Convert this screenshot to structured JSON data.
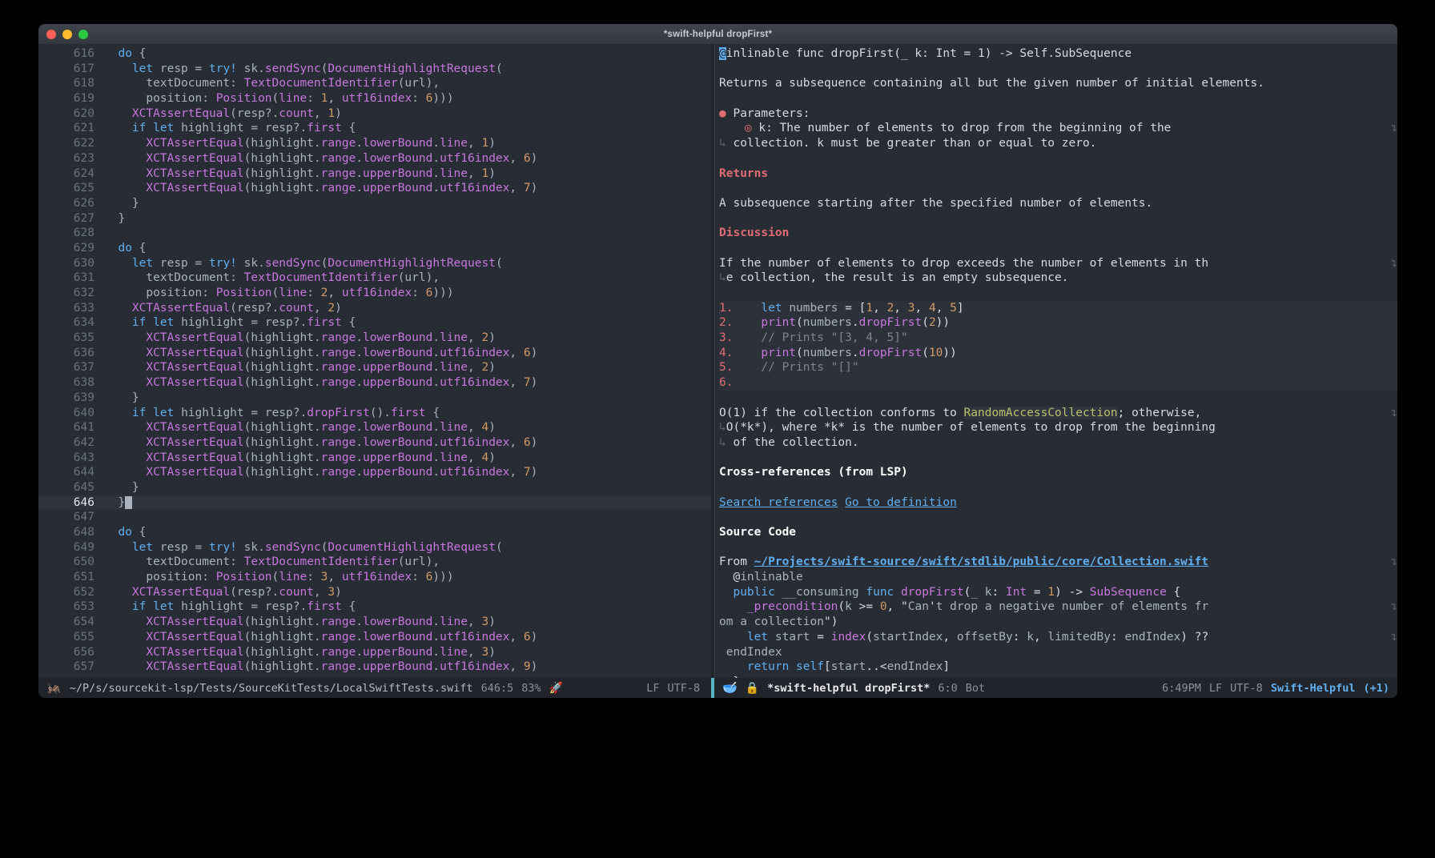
{
  "window": {
    "title": "*swift-helpful dropFirst*",
    "traffic_lights": [
      "close-button",
      "minimize-button",
      "zoom-button"
    ]
  },
  "editor_left": {
    "first_line": 616,
    "current_line": 646,
    "lines": [
      {
        "n": 616,
        "text": "  do {"
      },
      {
        "n": 617,
        "text": "    let resp = try! sk.sendSync(DocumentHighlightRequest("
      },
      {
        "n": 618,
        "text": "      textDocument: TextDocumentIdentifier(url),"
      },
      {
        "n": 619,
        "text": "      position: Position(line: 1, utf16index: 6)))"
      },
      {
        "n": 620,
        "text": "    XCTAssertEqual(resp?.count, 1)"
      },
      {
        "n": 621,
        "text": "    if let highlight = resp?.first {"
      },
      {
        "n": 622,
        "text": "      XCTAssertEqual(highlight.range.lowerBound.line, 1)"
      },
      {
        "n": 623,
        "text": "      XCTAssertEqual(highlight.range.lowerBound.utf16index, 6)"
      },
      {
        "n": 624,
        "text": "      XCTAssertEqual(highlight.range.upperBound.line, 1)"
      },
      {
        "n": 625,
        "text": "      XCTAssertEqual(highlight.range.upperBound.utf16index, 7)"
      },
      {
        "n": 626,
        "text": "    }"
      },
      {
        "n": 627,
        "text": "  }"
      },
      {
        "n": 628,
        "text": ""
      },
      {
        "n": 629,
        "text": "  do {"
      },
      {
        "n": 630,
        "text": "    let resp = try! sk.sendSync(DocumentHighlightRequest("
      },
      {
        "n": 631,
        "text": "      textDocument: TextDocumentIdentifier(url),"
      },
      {
        "n": 632,
        "text": "      position: Position(line: 2, utf16index: 6)))"
      },
      {
        "n": 633,
        "text": "    XCTAssertEqual(resp?.count, 2)"
      },
      {
        "n": 634,
        "text": "    if let highlight = resp?.first {"
      },
      {
        "n": 635,
        "text": "      XCTAssertEqual(highlight.range.lowerBound.line, 2)"
      },
      {
        "n": 636,
        "text": "      XCTAssertEqual(highlight.range.lowerBound.utf16index, 6)"
      },
      {
        "n": 637,
        "text": "      XCTAssertEqual(highlight.range.upperBound.line, 2)"
      },
      {
        "n": 638,
        "text": "      XCTAssertEqual(highlight.range.upperBound.utf16index, 7)"
      },
      {
        "n": 639,
        "text": "    }"
      },
      {
        "n": 640,
        "text": "    if let highlight = resp?.dropFirst().first {"
      },
      {
        "n": 641,
        "text": "      XCTAssertEqual(highlight.range.lowerBound.line, 4)"
      },
      {
        "n": 642,
        "text": "      XCTAssertEqual(highlight.range.lowerBound.utf16index, 6)"
      },
      {
        "n": 643,
        "text": "      XCTAssertEqual(highlight.range.upperBound.line, 4)"
      },
      {
        "n": 644,
        "text": "      XCTAssertEqual(highlight.range.upperBound.utf16index, 7)"
      },
      {
        "n": 645,
        "text": "    }"
      },
      {
        "n": 646,
        "text": "  }"
      },
      {
        "n": 647,
        "text": ""
      },
      {
        "n": 648,
        "text": "  do {"
      },
      {
        "n": 649,
        "text": "    let resp = try! sk.sendSync(DocumentHighlightRequest("
      },
      {
        "n": 650,
        "text": "      textDocument: TextDocumentIdentifier(url),"
      },
      {
        "n": 651,
        "text": "      position: Position(line: 3, utf16index: 6)))"
      },
      {
        "n": 652,
        "text": "    XCTAssertEqual(resp?.count, 3)"
      },
      {
        "n": 653,
        "text": "    if let highlight = resp?.first {"
      },
      {
        "n": 654,
        "text": "      XCTAssertEqual(highlight.range.lowerBound.line, 3)"
      },
      {
        "n": 655,
        "text": "      XCTAssertEqual(highlight.range.lowerBound.utf16index, 6)"
      },
      {
        "n": 656,
        "text": "      XCTAssertEqual(highlight.range.upperBound.line, 3)"
      },
      {
        "n": 657,
        "text": "      XCTAssertEqual(highlight.range.upperBound.utf16index, 9)"
      }
    ]
  },
  "doc": {
    "signature": "@inlinable func dropFirst(_ k: Int = 1) -> Self.SubSequence",
    "summary": "Returns a subsequence containing all but the given number of initial elements.",
    "parameters_heading": "Parameters:",
    "parameter_item": "k: The number of elements to drop from the beginning of the collection. k must be greater than or equal to zero.",
    "returns_heading": "Returns",
    "returns_text": "A subsequence starting after the specified number of elements.",
    "discussion_heading": "Discussion",
    "discussion_text": "If the number of elements to drop exceeds the number of elements in the collection, the result is an empty subsequence.",
    "example_code": [
      {
        "n": "1.",
        "text": "    let numbers = [1, 2, 3, 4, 5]"
      },
      {
        "n": "2.",
        "text": "    print(numbers.dropFirst(2))"
      },
      {
        "n": "3.",
        "text": "    // Prints \"[3, 4, 5]\""
      },
      {
        "n": "4.",
        "text": "    print(numbers.dropFirst(10))"
      },
      {
        "n": "5.",
        "text": "    // Prints \"[]\""
      },
      {
        "n": "6.",
        "text": ""
      }
    ],
    "complexity_text": "O(1) if the collection conforms to RandomAccessCollection; otherwise, O(*k*), where *k* is the number of elements to drop from the beginning of the collection.",
    "complexity_marked_term": "RandomAccessCollection",
    "crossrefs_heading": "Cross-references (from LSP)",
    "link_search_references": "Search references",
    "link_go_to_definition": "Go to definition",
    "source_code_heading": "Source Code",
    "source_from_label": "From",
    "source_path": "~/Projects/swift-source/swift/stdlib/public/core/Collection.swift",
    "source_lines": [
      "  @inlinable",
      "  public __consuming func dropFirst(_ k: Int = 1) -> SubSequence {",
      "    _precondition(k >= 0, \"Can't drop a negative number of elements from a collection\")",
      "    let start = index(startIndex, offsetBy: k, limitedBy: endIndex) ?? endIndex",
      "    return self[start..<endIndex]",
      "  }"
    ]
  },
  "modeline_left": {
    "icon": "swift-bird-icon",
    "path": "~/P/s/sourcekit-lsp/Tests/SourceKitTests/LocalSwiftTests.swift",
    "position": "646:5",
    "scroll": "83%",
    "rocket_icon": "rocket-icon",
    "eol": "LF",
    "encoding": "UTF-8"
  },
  "modeline_right": {
    "pretzel_icon": "emacs-pretzel-icon",
    "lock_icon": "lock-icon",
    "buffer": "*swift-helpful dropFirst*",
    "position": "6:0",
    "scroll": "Bot",
    "time": "6:49PM",
    "eol": "LF",
    "encoding": "UTF-8",
    "major_mode": "Swift-Helpful",
    "minor_modes": "(+1)"
  },
  "colors": {
    "background": "#282c34",
    "foreground": "#abb2bf",
    "keyword": "#61afef",
    "type": "#c678dd",
    "number": "#d19a66",
    "string": "#98c379",
    "heading": "#e06c75",
    "link": "#61afef",
    "modeline_bg": "#21242b",
    "accent": "#56b6c2"
  }
}
